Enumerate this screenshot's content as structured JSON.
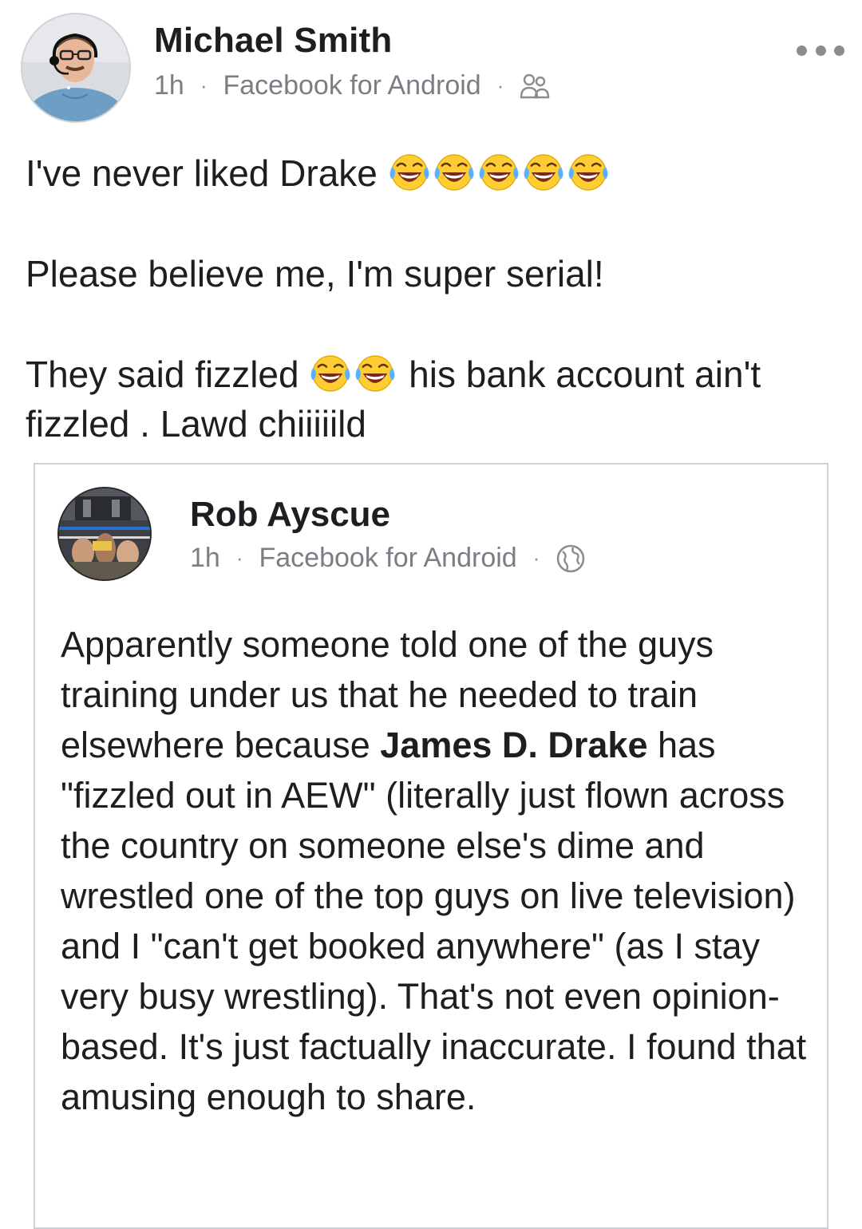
{
  "post": {
    "author": "Michael Smith",
    "time": "1h",
    "source": "Facebook for Android",
    "separator": "·",
    "audience_icon": "friends-icon",
    "more_icon": "more-horizontal-icon",
    "body": {
      "line1_text": "I've never liked Drake",
      "line1_emoji_count": 5,
      "line2": "Please believe me, I'm super serial!",
      "line3_before": "They said fizzled",
      "line3_emoji_count": 2,
      "line3_after": "his bank account ain't fizzled . Lawd chiiiiild",
      "emoji_icon": "face-with-tears-of-joy-icon"
    }
  },
  "shared_post": {
    "author": "Rob Ayscue",
    "time": "1h",
    "source": "Facebook for Android",
    "separator": "·",
    "audience_icon": "globe-icon",
    "body": {
      "part1": "Apparently someone told one of the guys training under us that he needed to train elsewhere because ",
      "mention": "James D. Drake",
      "part2": " has \"fizzled out in AEW\" (literally just flown across the country on someone else's dime and wrestled one of the top guys on live television) and I \"can't get booked anywhere\" (as I stay very busy wrestling). That's not even opinion-based. It's just factually inaccurate. I found that amusing enough to share."
    }
  },
  "colors": {
    "text": "#1c1e21",
    "meta": "#7a7e84",
    "border": "#cdd0d4",
    "emoji_face": "#ffcc33",
    "emoji_tear": "#5ab0ff"
  }
}
